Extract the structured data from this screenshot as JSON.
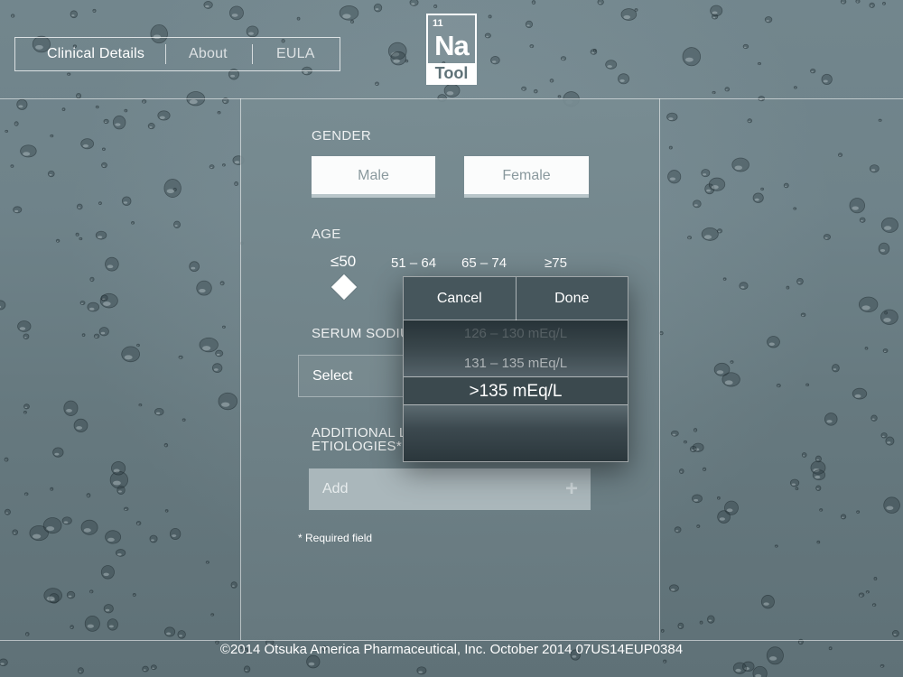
{
  "nav": {
    "items": [
      {
        "label": "Clinical Details",
        "active": true
      },
      {
        "label": "About",
        "active": false
      },
      {
        "label": "EULA",
        "active": false
      }
    ]
  },
  "logo": {
    "number": "11",
    "symbol": "Na",
    "word": "Tool"
  },
  "form": {
    "gender": {
      "label": "GENDER",
      "options": [
        "Male",
        "Female"
      ]
    },
    "age": {
      "label": "AGE",
      "options": [
        "≤50",
        "51 – 64",
        "65 – 74",
        "≥75"
      ],
      "selected": "≤50"
    },
    "serum_sodium": {
      "label": "SERUM SODIU",
      "value": "Select"
    },
    "additional": {
      "label_line1": "ADDITIONAL L",
      "label_line2": "ETIOLOGIES*",
      "placeholder": "Add",
      "add_icon": "plus-icon"
    },
    "required_note": "* Required field"
  },
  "picker": {
    "cancel_label": "Cancel",
    "done_label": "Done",
    "options": [
      "126 – 130 mEq/L",
      "131 – 135 mEq/L",
      ">135 mEq/L"
    ],
    "selected": ">135 mEq/L"
  },
  "footer": {
    "text": "©2014 Otsuka America Pharmaceutical, Inc. October 2014   07US14EUP0384"
  },
  "colors": {
    "background": "#6f838a",
    "panel": "#75898f",
    "picker": "#2f3d42",
    "button_text": "#8a999e"
  }
}
